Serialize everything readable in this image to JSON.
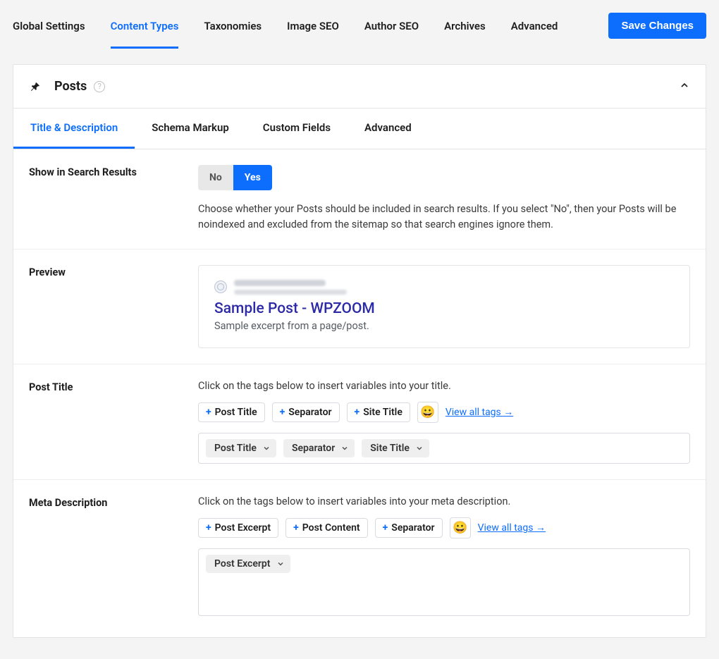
{
  "topTabs": {
    "global": "Global Settings",
    "content": "Content Types",
    "tax": "Taxonomies",
    "image": "Image SEO",
    "author": "Author SEO",
    "archives": "Archives",
    "advanced": "Advanced"
  },
  "saveButton": "Save Changes",
  "panel": {
    "title": "Posts"
  },
  "subTabs": {
    "title": "Title & Description",
    "schema": "Schema Markup",
    "custom": "Custom Fields",
    "advanced": "Advanced"
  },
  "showInSearch": {
    "label": "Show in Search Results",
    "no": "No",
    "yes": "Yes",
    "help": "Choose whether your Posts should be included in search results. If you select \"No\", then your Posts will be noindexed and excluded from the sitemap so that search engines ignore them."
  },
  "preview": {
    "label": "Preview",
    "title": "Sample Post - WPZOOM",
    "desc": "Sample excerpt from a page/post."
  },
  "postTitle": {
    "label": "Post Title",
    "hint": "Click on the tags below to insert variables into your title.",
    "tags": {
      "postTitle": "Post Title",
      "separator": "Separator",
      "siteTitle": "Site Title"
    },
    "viewAll": "View all tags →",
    "chips": {
      "postTitle": "Post Title",
      "separator": "Separator",
      "siteTitle": "Site Title"
    }
  },
  "metaDesc": {
    "label": "Meta Description",
    "hint": "Click on the tags below to insert variables into your meta description.",
    "tags": {
      "postExcerpt": "Post Excerpt",
      "postContent": "Post Content",
      "separator": "Separator"
    },
    "viewAll": "View all tags →",
    "chips": {
      "postExcerpt": "Post Excerpt"
    }
  }
}
